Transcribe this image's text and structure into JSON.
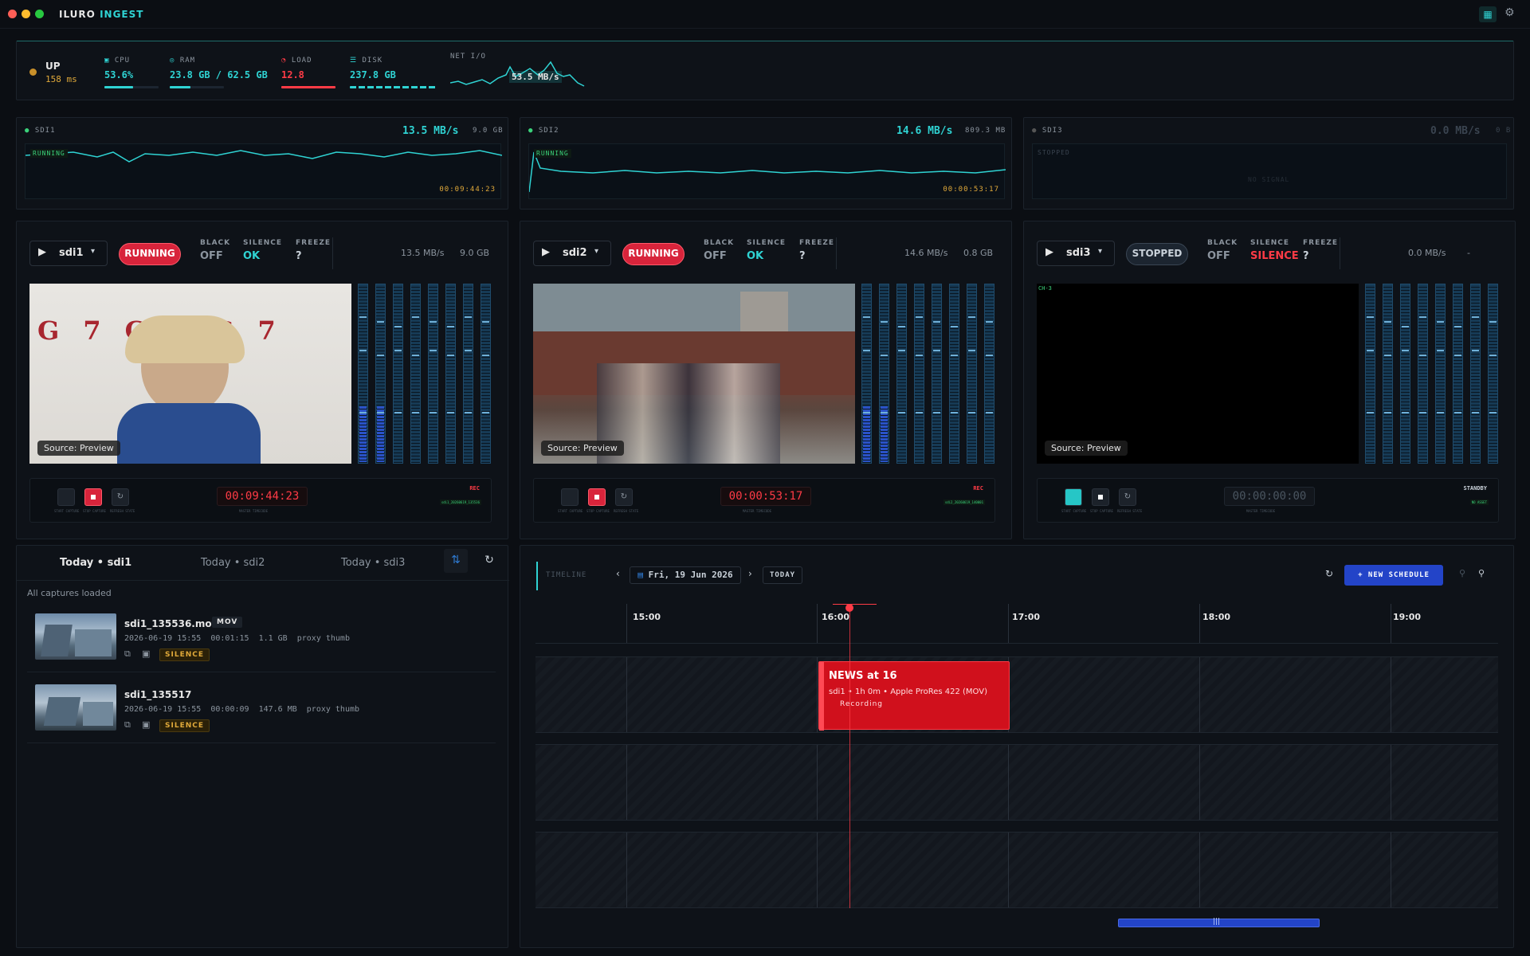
{
  "app": {
    "title_a": "ILURO",
    "title_b": "INGEST"
  },
  "system": {
    "status": "UP",
    "latency": "158 ms",
    "cpu": {
      "label": "CPU",
      "value": "53.6%",
      "fill": 0.536
    },
    "ram": {
      "label": "RAM",
      "value": "23.8 GB / 62.5 GB",
      "fill": 0.38
    },
    "load": {
      "label": "LOAD",
      "value": "12.8"
    },
    "disk": {
      "label": "DISK",
      "value": "237.8 GB"
    },
    "net": {
      "label": "NET I/O",
      "value": "53.5 MB/s"
    }
  },
  "strips": [
    {
      "name": "SDI1",
      "rate": "13.5 MB/s",
      "size": "9.0 GB",
      "state": "RUNNING",
      "tc": "00:09:44:23"
    },
    {
      "name": "SDI2",
      "rate": "14.6 MB/s",
      "size": "809.3 MB",
      "state": "RUNNING",
      "tc": "00:00:53:17"
    },
    {
      "name": "SDI3",
      "rate": "0.0 MB/s",
      "size": "0 B",
      "state": "STOPPED",
      "nosignal": "NO SIGNAL"
    }
  ],
  "channels": [
    {
      "id": "sdi1",
      "status": "RUNNING",
      "black_k": "BLACK",
      "black": "OFF",
      "silence_k": "SILENCE",
      "silence": "OK",
      "freeze_k": "FREEZE",
      "freeze": "?",
      "rate": "13.5 MB/s",
      "size": "9.0 GB",
      "source": "Source: Preview",
      "tc": "00:09:44:23",
      "rec": "REC",
      "tc_label": "MASTER TIMECODE",
      "btn_labels": [
        "START CAPTURE",
        "STOP CAPTURE",
        "REFRESH STATE"
      ],
      "file": "sdi1_20260619_135536"
    },
    {
      "id": "sdi2",
      "status": "RUNNING",
      "black_k": "BLACK",
      "black": "OFF",
      "silence_k": "SILENCE",
      "silence": "OK",
      "freeze_k": "FREEZE",
      "freeze": "?",
      "rate": "14.6 MB/s",
      "size": "0.8 GB",
      "source": "Source: Preview",
      "tc": "00:00:53:17",
      "rec": "REC",
      "tc_label": "MASTER TIMECODE",
      "btn_labels": [
        "START CAPTURE",
        "STOP CAPTURE",
        "REFRESH STATE"
      ],
      "file": "sdi2_20260619_140001"
    },
    {
      "id": "sdi3",
      "status": "STOPPED",
      "black_k": "BLACK",
      "black": "OFF",
      "silence_k": "SILENCE",
      "silence": "SILENCE",
      "freeze_k": "FREEZE",
      "freeze": "?",
      "rate": "0.0 MB/s",
      "size": "-",
      "source": "Source: Preview",
      "tc": "00:00:00:00",
      "rec": "STANDBY",
      "tc_label": "MASTER TIMECODE",
      "btn_labels": [
        "START CAPTURE",
        "STOP CAPTURE",
        "REFRESH STATE"
      ],
      "file": "NO ASSET",
      "corner": "CH-3"
    }
  ],
  "captures": {
    "tabs": [
      "Today • sdi1",
      "Today • sdi2",
      "Today • sdi3"
    ],
    "status": "All captures loaded",
    "items": [
      {
        "name": "sdi1_135536.mov",
        "format": "MOV",
        "meta": "2026-06-19 15:55  00:01:15  1.1 GB  proxy thumb",
        "flag": "SILENCE"
      },
      {
        "name": "sdi1_135517",
        "format": "",
        "meta": "2026-06-19 15:55  00:00:09  147.6 MB  proxy thumb",
        "flag": "SILENCE"
      }
    ]
  },
  "timeline": {
    "label": "TIMELINE",
    "date": "Fri, 19 Jun 2026",
    "today": "TODAY",
    "new_schedule": "+ NEW SCHEDULE",
    "hours": [
      "15:00",
      "16:00",
      "17:00",
      "18:00",
      "19:00"
    ],
    "event": {
      "title": "NEWS at 16",
      "detail": "sdi1 • 1h 0m • Apple ProRes 422 (MOV)",
      "state": "Recording"
    }
  },
  "colors": {
    "accent": "#2fd3d3",
    "danger": "#ff3b46",
    "warn": "#e0a93a",
    "brand": "#2344c8"
  }
}
